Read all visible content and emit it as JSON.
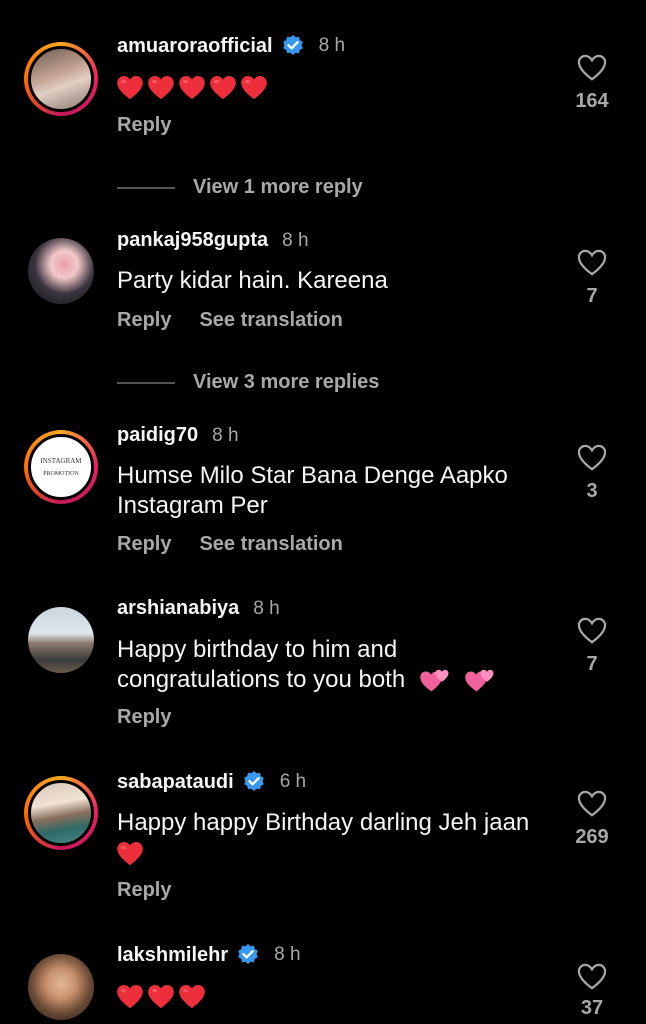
{
  "comments": [
    {
      "username": "amuaroraofficial",
      "verified": true,
      "time": "8 h",
      "text_emoji": "red-hearts-x5",
      "actions": [
        "Reply"
      ],
      "likes": "164",
      "more_replies": "View 1 more reply"
    },
    {
      "username": "pankaj958gupta",
      "verified": false,
      "time": "8 h",
      "text": "Party kidar hain. Kareena",
      "actions": [
        "Reply",
        "See translation"
      ],
      "likes": "7",
      "more_replies": "View 3 more replies"
    },
    {
      "username": "paidig70",
      "verified": false,
      "time": "8 h",
      "text": "Humse Milo Star Bana Denge Aapko Instagram Per",
      "avatar_text": [
        "INSTAGRAM",
        "PROMOTION"
      ],
      "actions": [
        "Reply",
        "See translation"
      ],
      "likes": "3"
    },
    {
      "username": "arshianabiya",
      "verified": false,
      "time": "8 h",
      "text": "Happy birthday to him and congratulations to you both",
      "actions": [
        "Reply"
      ],
      "likes": "7"
    },
    {
      "username": "sabapataudi",
      "verified": true,
      "time": "6 h",
      "text": "Happy happy Birthday darling Jeh jaan",
      "actions": [
        "Reply"
      ],
      "likes": "269"
    },
    {
      "username": "lakshmilehr",
      "verified": true,
      "time": "8 h",
      "text_emoji": "red-hearts-x3",
      "likes": "37"
    }
  ],
  "colors": {
    "background": "#000000",
    "text": "#f5f5f5",
    "muted": "#a8a8a8",
    "verified": "#3897f0",
    "heart": "#ed2f3c",
    "pink_heart": "#f0609a"
  }
}
